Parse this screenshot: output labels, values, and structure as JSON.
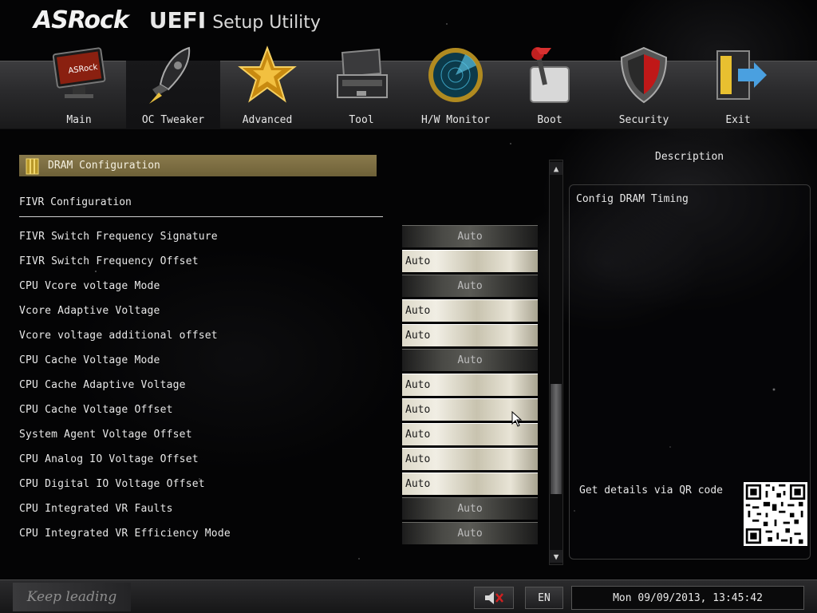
{
  "header": {
    "brand": "ASRock",
    "product": "UEFI",
    "subtitle": "Setup Utility"
  },
  "nav": {
    "active": "OC Tweaker",
    "items": [
      {
        "label": "Main",
        "icon": "monitor-icon"
      },
      {
        "label": "OC Tweaker",
        "icon": "rocket-icon"
      },
      {
        "label": "Advanced",
        "icon": "star-icon"
      },
      {
        "label": "Tool",
        "icon": "toolbox-icon"
      },
      {
        "label": "H/W Monitor",
        "icon": "radar-icon"
      },
      {
        "label": "Boot",
        "icon": "switch-icon"
      },
      {
        "label": "Security",
        "icon": "shield-icon"
      },
      {
        "label": "Exit",
        "icon": "exit-door-icon"
      }
    ]
  },
  "main": {
    "section_header": "DRAM Configuration",
    "group_title": "FIVR Configuration",
    "settings": [
      {
        "label": "FIVR Switch Frequency Signature",
        "value": "Auto",
        "style": "dark"
      },
      {
        "label": "FIVR Switch Frequency Offset",
        "value": "Auto",
        "style": "light"
      },
      {
        "label": "CPU Vcore voltage Mode",
        "value": "Auto",
        "style": "dark"
      },
      {
        "label": "Vcore Adaptive Voltage",
        "value": "Auto",
        "style": "light"
      },
      {
        "label": "Vcore voltage additional offset",
        "value": "Auto",
        "style": "light"
      },
      {
        "label": "CPU Cache Voltage Mode",
        "value": "Auto",
        "style": "dark"
      },
      {
        "label": "CPU Cache Adaptive Voltage",
        "value": "Auto",
        "style": "light"
      },
      {
        "label": "CPU Cache Voltage Offset",
        "value": "Auto",
        "style": "light"
      },
      {
        "label": "System Agent Voltage Offset",
        "value": "Auto",
        "style": "light"
      },
      {
        "label": "CPU Analog IO Voltage Offset",
        "value": "Auto",
        "style": "light"
      },
      {
        "label": "CPU Digital IO Voltage Offset",
        "value": "Auto",
        "style": "light"
      },
      {
        "label": "CPU Integrated VR Faults",
        "value": "Auto",
        "style": "dark"
      },
      {
        "label": "CPU Integrated VR Efficiency Mode",
        "value": "Auto",
        "style": "dark"
      }
    ]
  },
  "description": {
    "title": "Description",
    "text": "Config DRAM Timing",
    "qr_label": "Get details via QR code"
  },
  "footer": {
    "tagline": "Keep leading",
    "language": "EN",
    "datetime": "Mon 09/09/2013, 13:45:42"
  },
  "colors": {
    "section_header": "#7d6e42",
    "panel_border": "#3a3a3a"
  }
}
